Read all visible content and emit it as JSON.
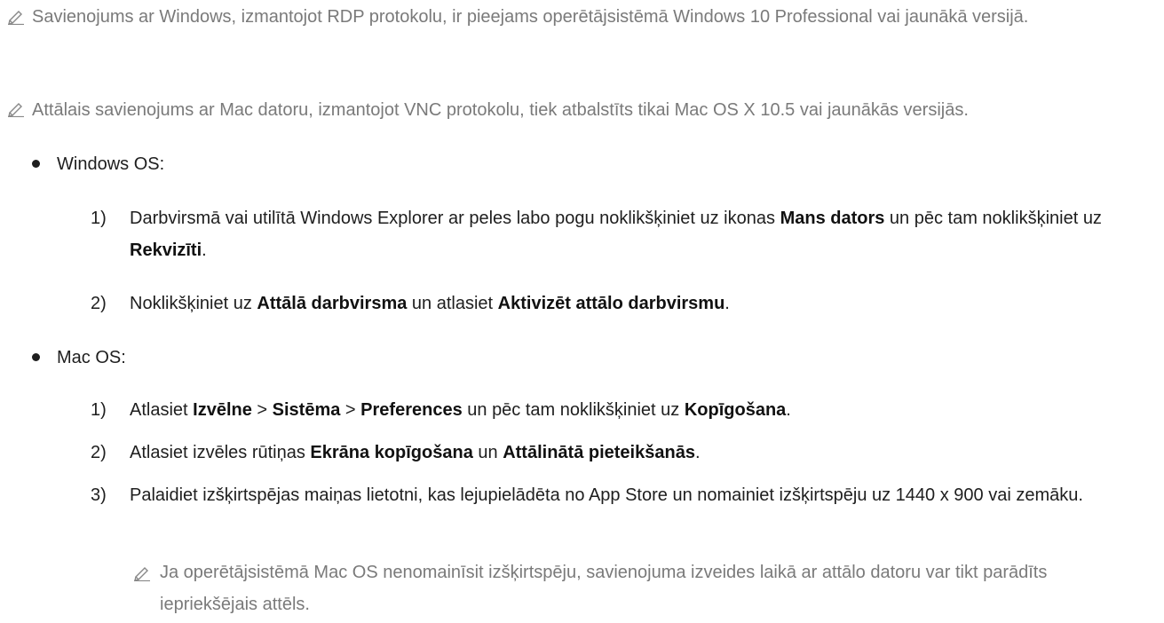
{
  "notes": [
    "Savienojums ar Windows, izmantojot RDP protokolu, ir pieejams operētājsistēmā Windows 10 Professional vai jaunākā versijā.",
    "Attālais savienojums ar Mac datoru, izmantojot VNC protokolu, tiek atbalstīts tikai Mac OS X 10.5 vai jaunākās versijās."
  ],
  "windows": {
    "label": "Windows OS:",
    "step1": {
      "num": "1)",
      "t1": "Darbvirsmā vai utilītā Windows Explorer ar peles labo pogu noklikšķiniet uz ikonas ",
      "b1": "Mans dators",
      "t2": " un pēc tam noklikšķiniet uz ",
      "b2": "Rekvizīti",
      "t3": "."
    },
    "step2": {
      "num": "2)",
      "t1": "Noklikšķiniet uz ",
      "b1": "Attālā darbvirsma",
      "t2": " un atlasiet ",
      "b2": "Aktivizēt attālo darbvirsmu",
      "t3": "."
    }
  },
  "mac": {
    "label": "Mac OS:",
    "step1": {
      "num": "1)",
      "t1": "Atlasiet ",
      "b1": "Izvēlne",
      "s1": " > ",
      "b2": "Sistēma",
      "s2": " > ",
      "b3": "Preferences",
      "t2": " un pēc tam noklikšķiniet uz ",
      "b4": "Kopīgošana",
      "t3": "."
    },
    "step2": {
      "num": "2)",
      "t1": "Atlasiet izvēles rūtiņas ",
      "b1": "Ekrāna kopīgošana",
      "t2": " un ",
      "b2": "Attālinātā pieteikšanās",
      "t3": "."
    },
    "step3": {
      "num": "3)",
      "text": "Palaidiet izšķirtspējas maiņas lietotni, kas lejupielādēta no App Store un nomainiet izšķirtspēju uz 1440 x 900 vai zemāku."
    },
    "subnote": "Ja operētājsistēmā Mac OS nenomainīsit izšķirtspēju, savienojuma izveides laikā ar attālo datoru var tikt parādīts iepriekšējais attēls."
  },
  "icons": {
    "note": "pencil-note-icon"
  }
}
